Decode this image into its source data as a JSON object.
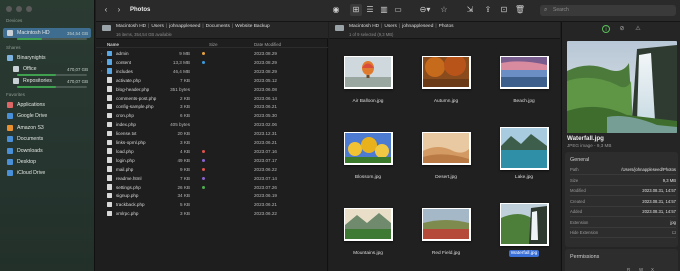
{
  "window": {
    "title": "Photos"
  },
  "sidebar": {
    "sections": {
      "devices": "Devices",
      "shares": "Shares",
      "favorites": "Favorites"
    },
    "devices": [
      {
        "label": "Macintosh HD",
        "size": "354,54 GB",
        "usage": 0.35,
        "color": "#3fa14f"
      }
    ],
    "shares": [
      {
        "label": "Binarynights"
      },
      {
        "label": "Office",
        "size": "470,07 GB",
        "usage": 0.55,
        "color": "#3fa14f"
      },
      {
        "label": "Repositories",
        "size": "470,07 GB",
        "usage": 0.55,
        "color": "#3fa14f"
      }
    ],
    "favorites": [
      {
        "label": "Applications",
        "icon": "applications-icon",
        "color": "#d66"
      },
      {
        "label": "Google Drive",
        "icon": "google-drive-icon",
        "color": "#4a90d9"
      },
      {
        "label": "Amazon S3",
        "icon": "amazon-s3-icon",
        "color": "#e8912e"
      },
      {
        "label": "Documents",
        "icon": "documents-icon",
        "color": "#4a90d9"
      },
      {
        "label": "Downloads",
        "icon": "downloads-icon",
        "color": "#4a90d9"
      },
      {
        "label": "Desktop",
        "icon": "desktop-icon",
        "color": "#4a90d9"
      },
      {
        "label": "iCloud Drive",
        "icon": "icloud-icon",
        "color": "#4a90d9"
      }
    ]
  },
  "toolbar": {
    "search_placeholder": "Search"
  },
  "left_pane": {
    "path": [
      "Macintosh HD",
      "Users",
      "johnappleseed",
      "Documents",
      "Website Backup"
    ],
    "info": "16 items, 354,54 GB available",
    "columns": {
      "name": "Name",
      "size": "Size",
      "date": "Date Modified"
    },
    "rows": [
      {
        "name": "admin",
        "type": "folder",
        "dot": "#e8a33d",
        "size": "9 MB",
        "date": "2023.08.29"
      },
      {
        "name": "content",
        "type": "folder",
        "dot": "#3b9de0",
        "size": "13,3 MB",
        "date": "2023.08.29"
      },
      {
        "name": "includes",
        "type": "folder",
        "dot": "",
        "size": "46,4 MB",
        "date": "2023.08.29"
      },
      {
        "name": "activate.php",
        "type": "file",
        "dot": "",
        "size": "7 KB",
        "date": "2023.05.12"
      },
      {
        "name": "blog-header.php",
        "type": "file",
        "dot": "",
        "size": "351 bytes",
        "date": "2023.06.08"
      },
      {
        "name": "comments-post.php",
        "type": "file",
        "dot": "",
        "size": "2 KB",
        "date": "2023.06.14"
      },
      {
        "name": "config-sample.php",
        "type": "file",
        "dot": "",
        "size": "3 KB",
        "date": "2023.06.21"
      },
      {
        "name": "cron.php",
        "type": "file",
        "dot": "",
        "size": "6 KB",
        "date": "2023.05.30"
      },
      {
        "name": "index.php",
        "type": "file",
        "dot": "",
        "size": "405 bytes",
        "date": "2023.02.06"
      },
      {
        "name": "license.txt",
        "type": "file",
        "dot": "",
        "size": "20 KB",
        "date": "2023.12.31"
      },
      {
        "name": "links-opml.php",
        "type": "file",
        "dot": "",
        "size": "3 KB",
        "date": "2023.06.21"
      },
      {
        "name": "load.php",
        "type": "file",
        "dot": "#e0524b",
        "size": "4 KB",
        "date": "2023.07.16"
      },
      {
        "name": "login.php",
        "type": "file",
        "dot": "#8a63d2",
        "size": "49 KB",
        "date": "2023.07.17"
      },
      {
        "name": "mail.php",
        "type": "file",
        "dot": "#e0524b",
        "size": "9 KB",
        "date": "2023.06.22"
      },
      {
        "name": "readme.html",
        "type": "file",
        "dot": "#8a63d2",
        "size": "7 KB",
        "date": "2023.07.14"
      },
      {
        "name": "settings.php",
        "type": "file",
        "dot": "#4caf50",
        "size": "26 KB",
        "date": "2023.07.26"
      },
      {
        "name": "signup.php",
        "type": "file",
        "dot": "",
        "size": "34 KB",
        "date": "2023.06.19"
      },
      {
        "name": "trackback.php",
        "type": "file",
        "dot": "",
        "size": "5 KB",
        "date": "2023.06.21"
      },
      {
        "name": "xmlrpc.php",
        "type": "file",
        "dot": "",
        "size": "3 KB",
        "date": "2023.06.22"
      }
    ]
  },
  "right_pane": {
    "path": [
      "Macintosh HD",
      "Users",
      "johnappleseed",
      "Photos"
    ],
    "info": "1 of 9 selected (9,3 MB)",
    "items": [
      {
        "label": "Air Balloon.jpg",
        "scene": "balloon",
        "orient": "landscape"
      },
      {
        "label": "Autumn.jpg",
        "scene": "autumn",
        "orient": "landscape"
      },
      {
        "label": "Beach.jpg",
        "scene": "beach",
        "orient": "landscape"
      },
      {
        "label": "Blossom.jpg",
        "scene": "blossom",
        "orient": "landscape"
      },
      {
        "label": "Desert.jpg",
        "scene": "desert",
        "orient": "landscape"
      },
      {
        "label": "Lake.jpg",
        "scene": "lake",
        "orient": "square"
      },
      {
        "label": "Mountains.jpg",
        "scene": "mountains",
        "orient": "landscape"
      },
      {
        "label": "Red Field.jpg",
        "scene": "redfield",
        "orient": "landscape"
      },
      {
        "label": "Waterfall.jpg",
        "scene": "waterfall",
        "orient": "square",
        "selected": true
      }
    ]
  },
  "info_pane": {
    "filename": "Waterfall.jpg",
    "subtitle": "JPEG image - 9,3 MB",
    "general_title": "General",
    "general": [
      {
        "k": "Path",
        "v": "/Users/johnappleseed/Photos"
      },
      {
        "k": "Size",
        "v": "9,3 MB"
      },
      {
        "k": "Modified",
        "v": "2023.08.31, 14:57"
      },
      {
        "k": "Created",
        "v": "2023.08.31, 14:57"
      },
      {
        "k": "Added",
        "v": "2023.08.31, 14:57"
      },
      {
        "k": "Extension",
        "v": "jpg"
      },
      {
        "k": "Hide Extension",
        "v": "☐"
      }
    ],
    "permissions_title": "Permissions",
    "permissions_cols": [
      "R",
      "W",
      "X"
    ]
  }
}
